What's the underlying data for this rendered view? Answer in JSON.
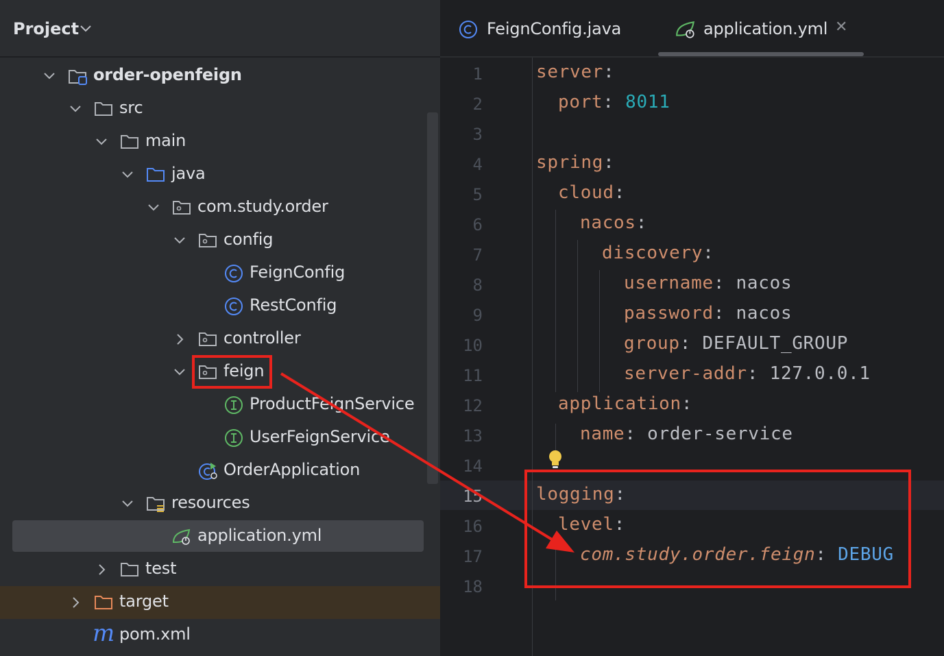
{
  "project_panel": {
    "title": "Project",
    "tree": [
      {
        "label": "order-openfeign",
        "icon": "module-folder-icon",
        "expanded": true
      },
      {
        "label": "src",
        "icon": "folder-icon",
        "expanded": true
      },
      {
        "label": "main",
        "icon": "folder-icon",
        "expanded": true
      },
      {
        "label": "java",
        "icon": "source-folder-icon",
        "expanded": true
      },
      {
        "label": "com.study.order",
        "icon": "package-icon",
        "expanded": true
      },
      {
        "label": "config",
        "icon": "package-icon",
        "expanded": true
      },
      {
        "label": "FeignConfig",
        "icon": "class-icon"
      },
      {
        "label": "RestConfig",
        "icon": "class-icon"
      },
      {
        "label": "controller",
        "icon": "package-icon",
        "expanded": false
      },
      {
        "label": "feign",
        "icon": "package-icon",
        "expanded": true
      },
      {
        "label": "ProductFeignService",
        "icon": "interface-icon"
      },
      {
        "label": "UserFeignService",
        "icon": "interface-icon"
      },
      {
        "label": "OrderApplication",
        "icon": "spring-boot-class-icon"
      },
      {
        "label": "resources",
        "icon": "resources-folder-icon",
        "expanded": true
      },
      {
        "label": "application.yml",
        "icon": "spring-yml-icon",
        "selected": true
      },
      {
        "label": "test",
        "icon": "folder-icon",
        "expanded": false
      },
      {
        "label": "target",
        "icon": "excluded-folder-icon",
        "expanded": false
      },
      {
        "label": "pom.xml",
        "icon": "maven-icon"
      }
    ]
  },
  "editor": {
    "tabs": [
      {
        "label": "FeignConfig.java",
        "icon": "class-icon",
        "active": false
      },
      {
        "label": "application.yml",
        "icon": "spring-yml-icon",
        "active": true,
        "close": "✕"
      }
    ],
    "line_numbers": [
      "1",
      "2",
      "3",
      "4",
      "5",
      "6",
      "7",
      "8",
      "9",
      "10",
      "11",
      "12",
      "13",
      "14",
      "15",
      "16",
      "17",
      "18"
    ],
    "code": {
      "l1_key": "server",
      "colon": ":",
      "l2_key": "port",
      "l2_val": "8011",
      "l4_key": "spring",
      "l5_key": "cloud",
      "l6_key": "nacos",
      "l7_key": "discovery",
      "l8_key": "username",
      "l8_val": "nacos",
      "l9_key": "password",
      "l9_val": "nacos",
      "l10_key": "group",
      "l10_val": "DEFAULT_GROUP",
      "l11_key": "server-addr",
      "l11_val": "127.0.0.1",
      "l12_key": "application",
      "l13_key": "name",
      "l13_val": "order-service",
      "l15_key": "logging",
      "l16_key": "level",
      "l17_key": "com.study.order.feign",
      "l17_val": "DEBUG"
    }
  },
  "colors": {
    "annotation_red": "#e8231d",
    "yaml_key": "#cf8e6d",
    "yaml_number": "#2aacb8",
    "yaml_enum": "#5da5e8"
  }
}
